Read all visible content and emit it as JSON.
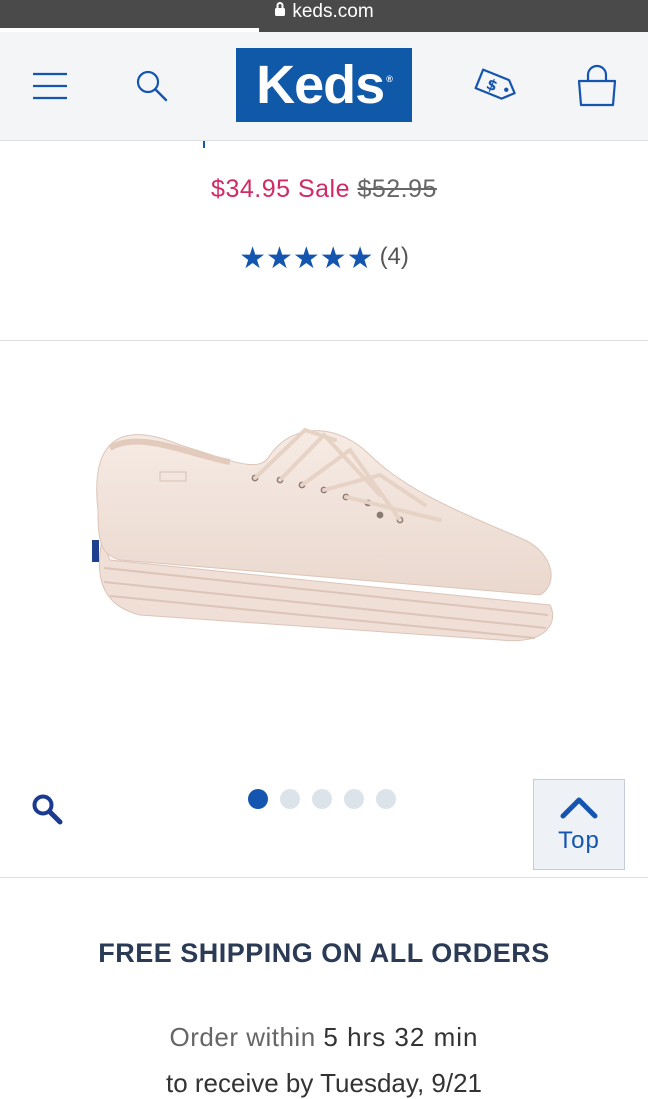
{
  "browser": {
    "url": "keds.com",
    "load_progress": 0.4
  },
  "header": {
    "logo_text": "Keds",
    "logo_mark": "®",
    "brand_color": "#1058a8"
  },
  "product": {
    "sale_price": "$34.95",
    "sale_label": "Sale",
    "original_price": "$52.95",
    "rating_stars": "★★★★★",
    "rating_value": 5,
    "review_count": "(4)",
    "image_name": "pink-platform-sneaker",
    "carousel": {
      "total": 5,
      "active": 1
    }
  },
  "top_button": {
    "label": "Top"
  },
  "banner": {
    "shipping": "FREE SHIPPING ON ALL ORDERS",
    "order_prefix": "Order within",
    "order_time": "5 hrs 32 min",
    "order_line2": "to receive by Tuesday, 9/21"
  },
  "colors": {
    "sale": "#d22a66",
    "accent": "#1455b0",
    "dark_text": "#2b3b55"
  }
}
